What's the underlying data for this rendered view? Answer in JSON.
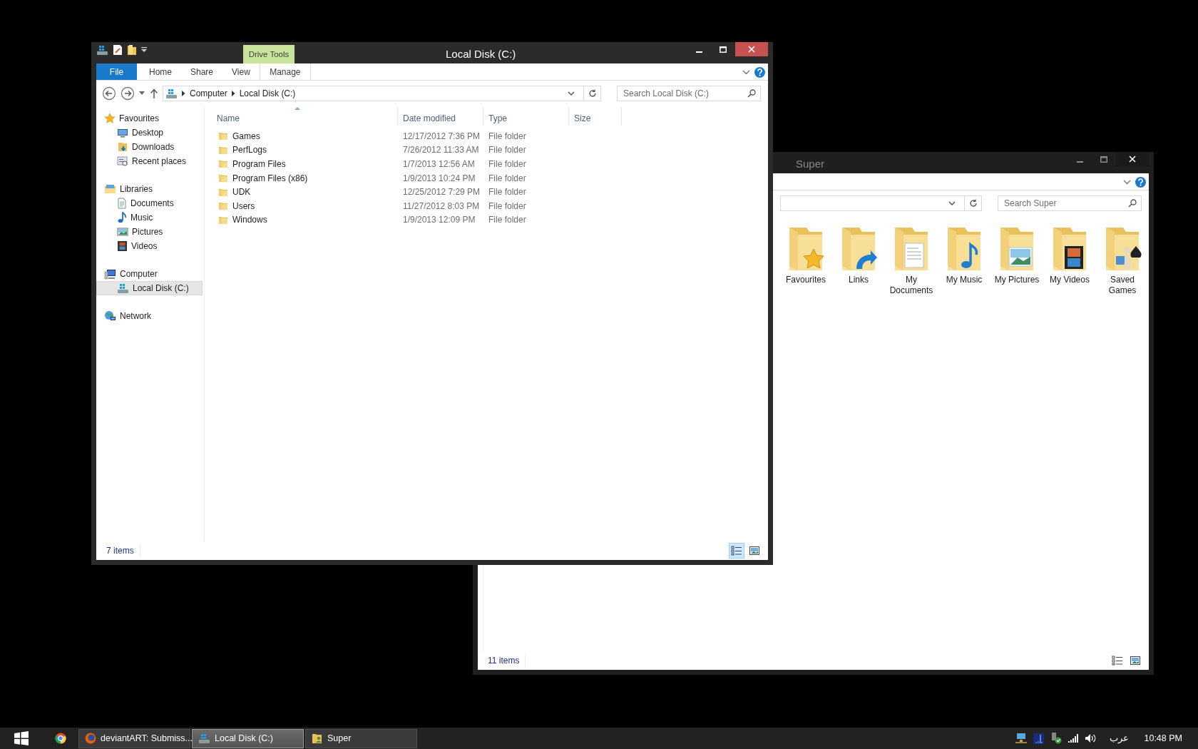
{
  "windows": [
    {
      "title": "Super",
      "active": false,
      "search": {
        "placeholder": "Search Super"
      },
      "items": [
        {
          "label": "Favourites"
        },
        {
          "label": "Links"
        },
        {
          "label": "My Documents"
        },
        {
          "label": "My Music"
        },
        {
          "label": "My Pictures"
        },
        {
          "label": "My Videos"
        },
        {
          "label": "Saved Games"
        }
      ],
      "status_bar": {
        "count": "11 items",
        "views": [
          {
            "kind": "details",
            "selected": false
          },
          {
            "kind": "large",
            "selected": false
          }
        ]
      }
    },
    {
      "title": "Local Disk (C:)",
      "active": true,
      "contextual_group": "Drive Tools",
      "ribbon_tabs": [
        {
          "label": "File",
          "kind": "file",
          "selected": false
        },
        {
          "label": "Home",
          "kind": "tab",
          "selected": false
        },
        {
          "label": "Share",
          "kind": "tab",
          "selected": false
        },
        {
          "label": "View",
          "kind": "tab",
          "selected": false
        },
        {
          "label": "Manage",
          "kind": "contextual",
          "selected": false
        }
      ],
      "address": {
        "path": [
          "Computer",
          "Local Disk (C:)"
        ]
      },
      "search": {
        "placeholder": "Search Local Disk (C:)"
      },
      "nav": [
        {
          "label": "Favourites",
          "selected": false,
          "children": [
            {
              "label": "Desktop",
              "selected": false
            },
            {
              "label": "Downloads",
              "selected": false
            },
            {
              "label": "Recent places",
              "selected": false
            }
          ]
        },
        {
          "label": "Libraries",
          "selected": false,
          "children": [
            {
              "label": "Documents",
              "selected": false
            },
            {
              "label": "Music",
              "selected": false
            },
            {
              "label": "Pictures",
              "selected": false
            },
            {
              "label": "Videos",
              "selected": false
            }
          ]
        },
        {
          "label": "Computer",
          "selected": false,
          "children": [
            {
              "label": "Local Disk (C:)",
              "selected": true
            }
          ]
        },
        {
          "label": "Network",
          "selected": false
        }
      ],
      "table": {
        "columns": [
          {
            "label": "Name",
            "sorted": true
          },
          {
            "label": "Date modified",
            "sorted": false
          },
          {
            "label": "Type",
            "sorted": false
          },
          {
            "label": "Size",
            "sorted": false
          }
        ],
        "rows": [
          {
            "name": "Games",
            "date": "12/17/2012 7:36 PM",
            "type": "File folder"
          },
          {
            "name": "PerfLogs",
            "date": "7/26/2012 11:33 AM",
            "type": "File folder"
          },
          {
            "name": "Program Files",
            "date": "1/7/2013 12:56 AM",
            "type": "File folder"
          },
          {
            "name": "Program Files (x86)",
            "date": "1/9/2013 10:24 PM",
            "type": "File folder"
          },
          {
            "name": "UDK",
            "date": "12/25/2012 7:29 PM",
            "type": "File folder"
          },
          {
            "name": "Users",
            "date": "11/27/2012 8:03 PM",
            "type": "File folder"
          },
          {
            "name": "Windows",
            "date": "1/9/2013 12:09 PM",
            "type": "File folder"
          }
        ]
      },
      "status_bar": {
        "count": "7 items",
        "views": [
          {
            "kind": "details",
            "selected": true
          },
          {
            "kind": "large",
            "selected": false
          }
        ]
      }
    }
  ],
  "taskbar": {
    "buttons": [
      {
        "label": "deviantART: Submiss...",
        "selected": false
      },
      {
        "label": "Local Disk (C:)",
        "selected": true
      },
      {
        "label": "Super",
        "selected": false
      }
    ],
    "tray": {
      "language": "عرب",
      "time": "10:48 PM"
    }
  }
}
